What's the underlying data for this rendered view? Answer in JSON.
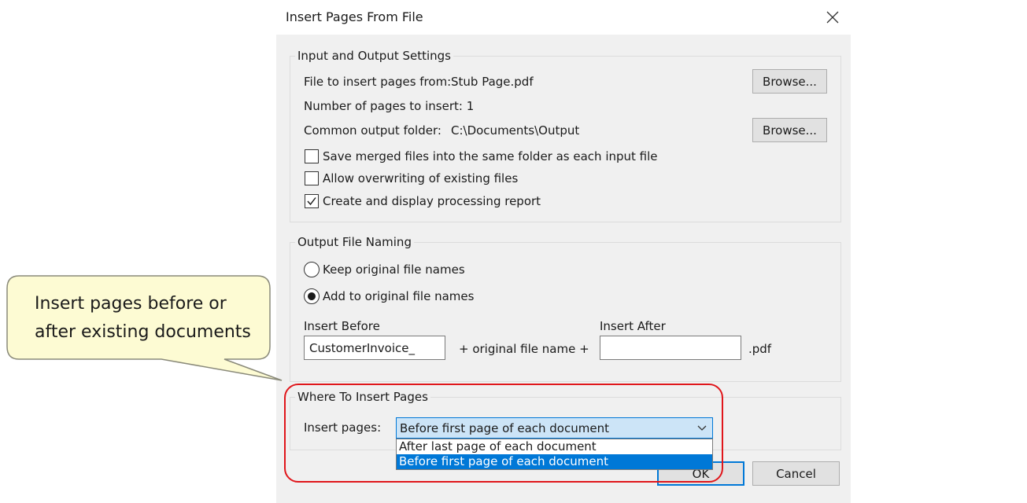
{
  "dialog": {
    "title": "Insert Pages From File",
    "close_icon": "close-icon"
  },
  "io_settings": {
    "label": "Input and Output Settings",
    "file_label": "File to insert pages from:",
    "file_value": "Stub Page.pdf",
    "browse_label": "Browse...",
    "pages_label": "Number of pages to insert: 1",
    "output_label": "Common output folder:",
    "output_value": "C:\\Documents\\Output",
    "checkboxes": [
      {
        "label": "Save merged files into the same folder as each input file",
        "checked": false
      },
      {
        "label": "Allow overwriting of existing files",
        "checked": false
      },
      {
        "label": "Create and display processing report",
        "checked": true
      }
    ]
  },
  "naming": {
    "label": "Output File Naming",
    "radios": [
      {
        "label": "Keep original file names",
        "selected": false
      },
      {
        "label": "Add to original file names",
        "selected": true
      }
    ],
    "before_label": "Insert Before",
    "before_value": "CustomerInvoice_",
    "middle_text": "+ original file name +",
    "after_label": "Insert After",
    "after_value": "",
    "ext": ".pdf"
  },
  "where": {
    "label": "Where To Insert Pages",
    "insert_label": "Insert pages:",
    "selected": "Before first page of each document",
    "options": [
      "After last page of each document",
      "Before first page of each document"
    ]
  },
  "buttons": {
    "ok": "OK",
    "cancel": "Cancel"
  },
  "callout": {
    "line1": "Insert pages before or",
    "line2": "after existing documents"
  },
  "colors": {
    "highlight": "#e0161b",
    "callout_fill": "#fdfbd3",
    "accent": "#0078d7"
  }
}
